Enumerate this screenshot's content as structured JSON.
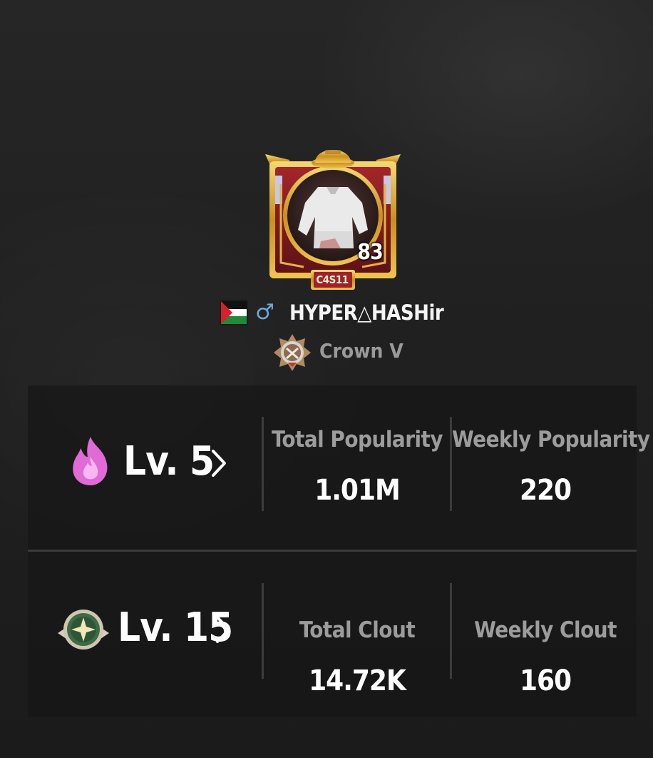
{
  "profile": {
    "avatar_level": "83",
    "avatar_tag": "C4S11",
    "name": "HYPER△HASHir",
    "gender_symbol": "♂",
    "flag": "palestine-flag-icon",
    "rank_name": "Crown V"
  },
  "popularity": {
    "level_label": "Lv. 5",
    "total_label": "Total Popularity",
    "total_value": "1.01M",
    "weekly_label": "Weekly Popularity",
    "weekly_value": "220",
    "icon": "flame-icon"
  },
  "clout": {
    "level_label": "Lv. 15",
    "total_label": "Total Clout",
    "total_value": "14.72K",
    "weekly_label": "Weekly Clout",
    "weekly_value": "160",
    "icon": "star-emblem-icon"
  },
  "colors": {
    "background": "#222222",
    "flame": "#e06ad6",
    "gender": "#6fa8d6",
    "frame_gold": "#d8a934",
    "frame_red": "#8e1d22",
    "label_gray": "#9c9c9c"
  }
}
